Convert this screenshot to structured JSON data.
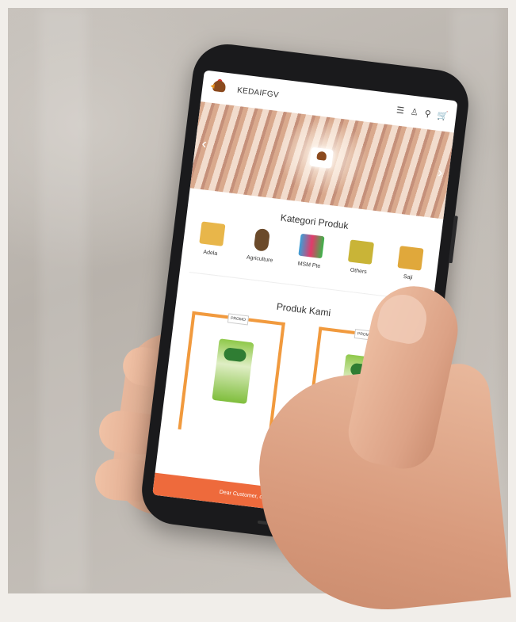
{
  "app": {
    "brand": "KEDAIFGV"
  },
  "header": {
    "icons": [
      {
        "name": "menu-icon",
        "glyph": "☰"
      },
      {
        "name": "user-icon",
        "glyph": "♙"
      },
      {
        "name": "search-icon",
        "glyph": "⚲"
      },
      {
        "name": "cart-icon",
        "glyph": "🛒"
      }
    ]
  },
  "hero": {
    "prev_glyph": "‹",
    "next_glyph": "›"
  },
  "categories": {
    "title": "Kategori Produk",
    "items": [
      {
        "label": "Adela",
        "color": "#e8b64a"
      },
      {
        "label": "Agriculture",
        "color": "#6b4a2a"
      },
      {
        "label": "MSM Pte",
        "color": "#3aa0d8"
      },
      {
        "label": "Others",
        "color": "#c9b437"
      },
      {
        "label": "Saji",
        "color": "#e0a83b"
      }
    ]
  },
  "products": {
    "title": "Produk Kami",
    "items": [
      {
        "tag": "PROMO"
      },
      {
        "tag": "PROMO"
      }
    ]
  },
  "banner": {
    "text": "Dear Customer, our minimum order amount is RM"
  },
  "colors": {
    "accent": "#ee6a3c",
    "product_border": "#f19a3e"
  }
}
